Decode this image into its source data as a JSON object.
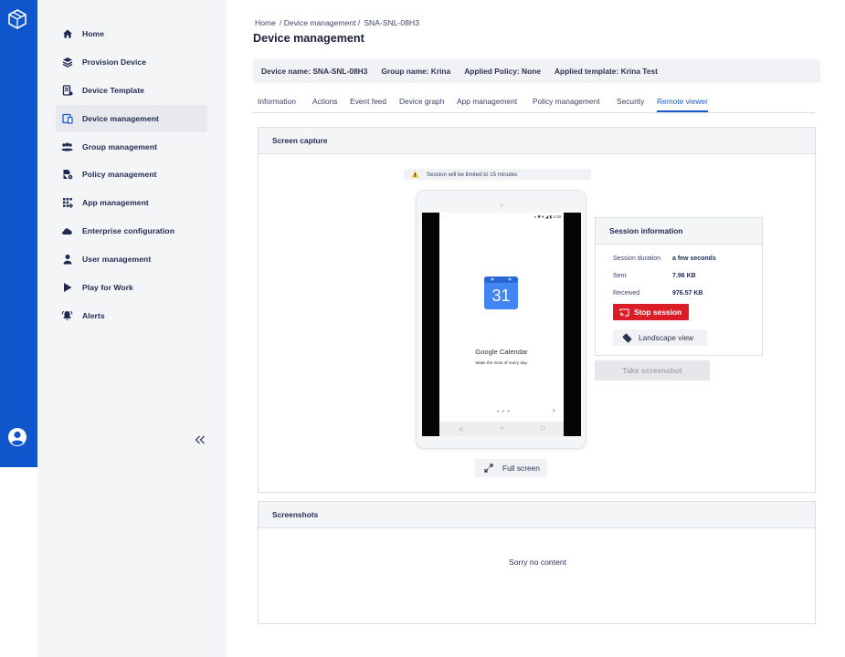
{
  "sidebar": {
    "items": [
      {
        "label": "Home",
        "icon": "home-icon"
      },
      {
        "label": "Provision Device",
        "icon": "provision-icon"
      },
      {
        "label": "Device Template",
        "icon": "template-icon"
      },
      {
        "label": "Device management",
        "icon": "devices-icon",
        "active": true
      },
      {
        "label": "Group management",
        "icon": "group-icon"
      },
      {
        "label": "Policy management",
        "icon": "policy-icon"
      },
      {
        "label": "App management",
        "icon": "apps-icon"
      },
      {
        "label": "Enterprise configuration",
        "icon": "cloud-icon"
      },
      {
        "label": "User management",
        "icon": "user-icon"
      },
      {
        "label": "Play for Work",
        "icon": "play-icon"
      },
      {
        "label": "Alerts",
        "icon": "bell-icon"
      }
    ],
    "collapse_label": "<<"
  },
  "breadcrumb": {
    "home": "Home",
    "section": "/ Device management /",
    "current": "SNA-SNL-08H3"
  },
  "page_title": "Device management",
  "infobar": {
    "device_name": "Device name: SNA-SNL-08H3",
    "group_name": "Group name: Krina",
    "applied_policy": "Applied Policy: None",
    "applied_template": "Applied template: Krina Test"
  },
  "tabs": [
    "Information",
    "Actions",
    "Event feed",
    "Device graph",
    "App management",
    "Policy management",
    "Security",
    "Remote viewer"
  ],
  "active_tab": "Remote viewer",
  "capture": {
    "title": "Screen capture",
    "warning": "Session will be limited to 15 minutes",
    "device_status": "⁎ ✱ ▾ ◢ ▮ 4:18",
    "app_icon_day": "31",
    "app_title": "Google Calendar",
    "app_subtitle": "Make the most of every day.",
    "page_dots": "• • •",
    "next_glyph": "›",
    "nav_back": "◁",
    "nav_home": "○",
    "nav_recent": "□",
    "fullscreen_label": "Full screen"
  },
  "session": {
    "title": "Session information",
    "duration_label": "Session duration",
    "duration_value": "a few seconds",
    "sent_label": "Sent",
    "sent_value": "7.96 KB",
    "received_label": "Received",
    "received_value": "976.57 KB",
    "stop_label": "Stop session",
    "landscape_label": "Landscape view",
    "screenshot_label": "Take screenshot"
  },
  "screenshots": {
    "title": "Screenshots",
    "empty": "Sorry no content"
  },
  "colors": {
    "brand": "#0f56cc",
    "accent": "#1c59c9",
    "danger": "#da1e28"
  }
}
